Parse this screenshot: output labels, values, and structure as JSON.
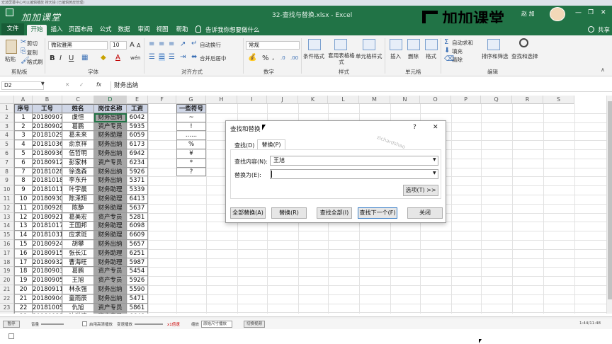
{
  "system_bar": {
    "text": "宏波屏幕中心可以编辑播放 搜天操 (已编辑黄皮管理)"
  },
  "window": {
    "title": "32-查找与替换.xlsx - Excel",
    "user": "赵 加",
    "share_label": "共享",
    "minimize": "—",
    "restore": "❐",
    "close": "✕"
  },
  "watermark": "加加课堂",
  "overlay_logo_text": "加加课堂",
  "tabs": [
    "文件",
    "开始",
    "插入",
    "页面布局",
    "公式",
    "数据",
    "审阅",
    "视图",
    "帮助"
  ],
  "active_tab": "开始",
  "tell_me": "告诉我你想要做什么",
  "ribbon": {
    "clipboard": {
      "paste": "粘贴",
      "cut": "剪切",
      "copy": "复制",
      "format_painter": "格式刷",
      "group": "剪贴板"
    },
    "font": {
      "name": "微软雅黑",
      "size": "10",
      "bold": "B",
      "italic": "I",
      "underline": "U",
      "grow": "A",
      "shrink": "A",
      "color_a": "A",
      "wen": "wén",
      "group": "字体"
    },
    "alignment": {
      "wrap": "自动换行",
      "merge": "合并后居中",
      "group": "对齐方式"
    },
    "number": {
      "format": "常规",
      "percent": "%",
      "comma": ",",
      "group": "数字"
    },
    "styles": {
      "conditional": "条件格式",
      "table": "套用表格格式",
      "cell": "单元格样式",
      "group": "样式"
    },
    "cells": {
      "insert": "插入",
      "delete": "删除",
      "format": "格式",
      "group": "单元格"
    },
    "editing": {
      "autosum": "自动求和",
      "fill": "填充",
      "clear": "清除",
      "sort": "排序和筛选",
      "find": "查找和选择",
      "group": "编辑"
    }
  },
  "formula_bar": {
    "name_box": "D2",
    "fx": "fx",
    "cancel": "✕",
    "enter": "✓",
    "content": "财务出纳"
  },
  "columns": [
    "A",
    "B",
    "C",
    "D",
    "E",
    "F",
    "G",
    "H",
    "I",
    "J",
    "K",
    "L",
    "M",
    "N",
    "O",
    "P",
    "Q",
    "R",
    "S"
  ],
  "rows": [
    "1",
    "2",
    "3",
    "4",
    "5",
    "6",
    "7",
    "8",
    "9",
    "10",
    "11",
    "12",
    "13",
    "14",
    "15",
    "16",
    "17",
    "18",
    "19",
    "20",
    "21",
    "22",
    "23",
    "24"
  ],
  "table": {
    "headers": [
      "序号",
      "工号",
      "姓名",
      "岗位名称",
      "工资"
    ],
    "rows": [
      [
        "1",
        "20180907",
        "虞恒",
        "财务出纳",
        "6042"
      ],
      [
        "2",
        "20180902",
        "葛鹏",
        "资产专员",
        "5935"
      ],
      [
        "3",
        "20181029",
        "葛未来",
        "财务助理",
        "6059"
      ],
      [
        "4",
        "20181036",
        "俞京祥",
        "财务出纳",
        "6173"
      ],
      [
        "5",
        "20180936",
        "伍哲明",
        "财务出纳",
        "6942"
      ],
      [
        "6",
        "20180912",
        "彭家林",
        "资产专员",
        "6234"
      ],
      [
        "7",
        "20181028",
        "徐逸森",
        "财务出纳",
        "5926"
      ],
      [
        "8",
        "20181018",
        "李东升",
        "财务出纳",
        "5371"
      ],
      [
        "9",
        "20181011",
        "叶宇晨",
        "财务助理",
        "5339"
      ],
      [
        "10",
        "20180930",
        "陈泽翔",
        "财务助理",
        "6413"
      ],
      [
        "11",
        "20180928",
        "陈静",
        "财务助理",
        "5637"
      ],
      [
        "12",
        "20180921",
        "葛美宏",
        "资产专员",
        "5281"
      ],
      [
        "13",
        "20181017",
        "王国邦",
        "财务助理",
        "6098"
      ],
      [
        "14",
        "20181031",
        "应求斑",
        "财务助理",
        "6609"
      ],
      [
        "15",
        "20180924",
        "胡攀",
        "财务出纳",
        "5657"
      ],
      [
        "16",
        "20180915",
        "张长江",
        "财务助理",
        "6251"
      ],
      [
        "17",
        "20180932",
        "曹海旺",
        "财务助理",
        "5987"
      ],
      [
        "18",
        "20180903",
        "葛鹏",
        "资产专员",
        "5454"
      ],
      [
        "19",
        "20180905",
        "王旭",
        "资产专员",
        "5926"
      ],
      [
        "20",
        "20180911",
        "林永强",
        "财务出纳",
        "5590"
      ],
      [
        "21",
        "20180904",
        "童雨辰",
        "财务出纳",
        "5471"
      ],
      [
        "22",
        "20181005",
        "仇旭",
        "资产专员",
        "5861"
      ],
      [
        "23",
        "20180922",
        "沈洪涛",
        "资产专员",
        "6648"
      ]
    ]
  },
  "symbols": {
    "header": "一些符号",
    "items": [
      "~",
      "!",
      "......",
      "%",
      "¥",
      "*",
      "?"
    ]
  },
  "dialog": {
    "title": "查找和替换",
    "help": "?",
    "close": "✕",
    "tabs": [
      "查找(D)",
      "替换(P)"
    ],
    "active_tab": "替换(P)",
    "find_label": "查找内容(N):",
    "find_value": "王旭",
    "replace_label": "替换为(E):",
    "replace_value": "",
    "options_button": "选项(T) >>",
    "buttons": [
      "全部替换(A)",
      "替换(R)",
      "查找全部(I)",
      "查找下一个(F)",
      "关闭"
    ]
  },
  "dialog_watermark": "zichardshao",
  "player": {
    "pause": "暂停",
    "volume": "音量",
    "hd_label": "启用高清播放",
    "speed_label": "变速播放",
    "speed_value": "x1倍速",
    "size_label": "缩放",
    "size_value": "原始尺寸播放",
    "switch": "切换视频",
    "time": "1:44/11:48"
  },
  "colors": {
    "excel_green": "#217346",
    "header_fill": "#cfd6e6",
    "post_fill": "#a6a6a6"
  }
}
